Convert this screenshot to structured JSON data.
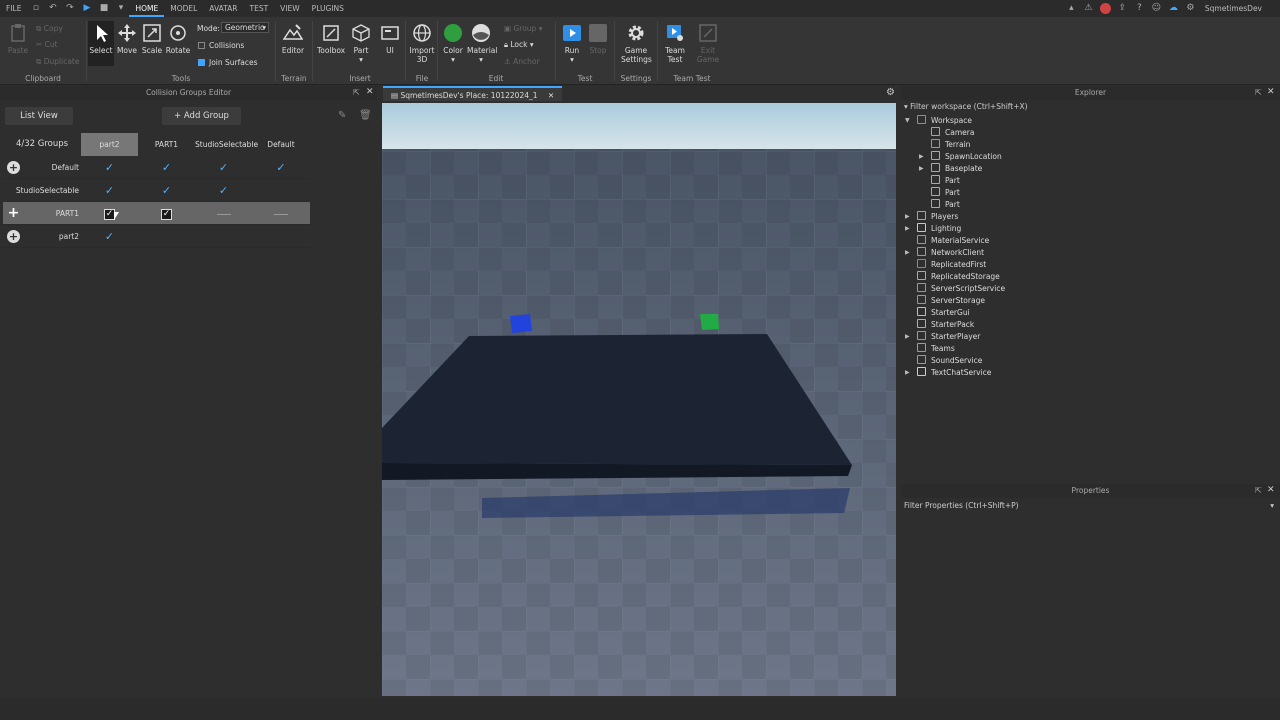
{
  "menubar": {
    "file": "FILE",
    "tabs": [
      {
        "label": "HOME",
        "active": true
      },
      {
        "label": "MODEL"
      },
      {
        "label": "AVATAR"
      },
      {
        "label": "TEST"
      },
      {
        "label": "VIEW"
      },
      {
        "label": "PLUGINS"
      }
    ],
    "username": "SqmetimesDev"
  },
  "ribbon": {
    "clipboard": {
      "label": "Clipboard",
      "paste": "Paste",
      "copy": "Copy",
      "cut": "Cut",
      "duplicate": "Duplicate"
    },
    "tools": {
      "label": "Tools",
      "select": "Select",
      "move": "Move",
      "scale": "Scale",
      "rotate": "Rotate",
      "mode_label": "Mode:",
      "mode_value": "Geometric",
      "collisions": "Collisions",
      "join_surfaces": "Join Surfaces"
    },
    "terrain": {
      "label": "Terrain",
      "editor": "Editor"
    },
    "insert": {
      "label": "Insert",
      "toolbox": "Toolbox",
      "part": "Part",
      "ui": "UI"
    },
    "file": {
      "label": "File",
      "import3d": "Import 3D"
    },
    "edit": {
      "label": "Edit",
      "color": "Color",
      "material": "Material",
      "group": "Group",
      "lock": "Lock",
      "anchor": "Anchor"
    },
    "test": {
      "label": "Test",
      "run": "Run",
      "stop": "Stop"
    },
    "settings": {
      "label": "Settings",
      "game_settings": "Game Settings"
    },
    "team_test": {
      "label": "Team Test",
      "team_test": "Team Test",
      "exit_game": "Exit Game"
    }
  },
  "collision_editor": {
    "title": "Collision Groups Editor",
    "list_view": "List View",
    "add_group": "+ Add Group",
    "group_count": "4/32 Groups",
    "columns": [
      "part2",
      "PART1",
      "StudioSelectable",
      "Default"
    ],
    "rows": [
      {
        "name": "Default",
        "cells": [
          "check",
          "check",
          "check",
          "check"
        ]
      },
      {
        "name": "StudioSelectable",
        "cells": [
          "check",
          "check",
          "check",
          ""
        ]
      },
      {
        "name": "PART1",
        "cells": [
          "box",
          "box",
          "dash",
          "dash"
        ],
        "selected": true
      },
      {
        "name": "part2",
        "cells": [
          "check",
          "",
          "",
          ""
        ]
      }
    ]
  },
  "viewport": {
    "tab_title": "SqmetimesDev's Place: 10122024_1"
  },
  "explorer": {
    "title": "Explorer",
    "filter": "Filter workspace (Ctrl+Shift+X)",
    "items": [
      {
        "label": "Workspace",
        "level": 0,
        "expanded": true,
        "color": "#4aa3df"
      },
      {
        "label": "Camera",
        "level": 1,
        "color": "#9aa"
      },
      {
        "label": "Terrain",
        "level": 1,
        "color": "#5b9"
      },
      {
        "label": "SpawnLocation",
        "level": 1,
        "arrow": true,
        "color": "#aaa"
      },
      {
        "label": "Baseplate",
        "level": 1,
        "arrow": true,
        "color": "#aaa"
      },
      {
        "label": "Part",
        "level": 1,
        "color": "#aaa"
      },
      {
        "label": "Part",
        "level": 1,
        "color": "#aaa"
      },
      {
        "label": "Part",
        "level": 1,
        "color": "#aaa"
      },
      {
        "label": "Players",
        "level": 0,
        "arrow": true,
        "color": "#7c5"
      },
      {
        "label": "Lighting",
        "level": 0,
        "arrow": true,
        "color": "#ec4"
      },
      {
        "label": "MaterialService",
        "level": 0,
        "color": "#6ad"
      },
      {
        "label": "NetworkClient",
        "level": 0,
        "arrow": true,
        "color": "#6ad"
      },
      {
        "label": "ReplicatedFirst",
        "level": 0,
        "color": "#d66"
      },
      {
        "label": "ReplicatedStorage",
        "level": 0,
        "color": "#c9a"
      },
      {
        "label": "ServerScriptService",
        "level": 0,
        "color": "#5b9"
      },
      {
        "label": "ServerStorage",
        "level": 0,
        "color": "#5b9"
      },
      {
        "label": "StarterGui",
        "level": 0,
        "color": "#eb5"
      },
      {
        "label": "StarterPack",
        "level": 0,
        "color": "#ca7"
      },
      {
        "label": "StarterPlayer",
        "level": 0,
        "arrow": true,
        "color": "#6ad"
      },
      {
        "label": "Teams",
        "level": 0,
        "color": "#6ad"
      },
      {
        "label": "SoundService",
        "level": 0,
        "color": "#6ad"
      },
      {
        "label": "TextChatService",
        "level": 0,
        "arrow": true,
        "color": "#ccc"
      }
    ]
  },
  "properties": {
    "title": "Properties",
    "filter": "Filter Properties (Ctrl+Shift+P)"
  }
}
